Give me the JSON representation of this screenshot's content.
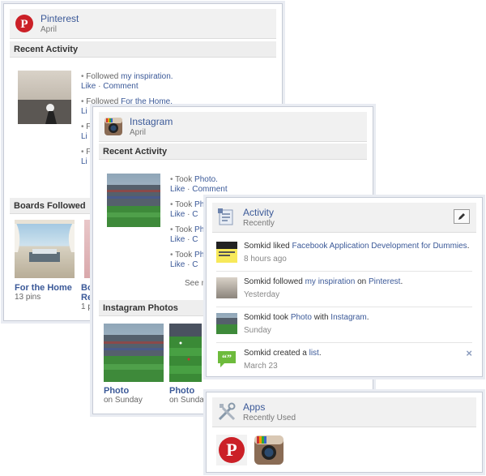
{
  "pinterest": {
    "title": "Pinterest",
    "subtitle": "April",
    "recent_activity_label": "Recent Activity",
    "items": [
      {
        "prefix": "Followed ",
        "link": "my inspiration.",
        "actions": [
          "Like",
          "Comment"
        ]
      },
      {
        "prefix": "Followed ",
        "link": "For the Home.",
        "actions": [
          "Li"
        ]
      },
      {
        "prefix": "Followed ",
        "link": "",
        "actions": [
          "Li"
        ]
      },
      {
        "prefix": "Followed ",
        "link": "",
        "actions": [
          "Li"
        ]
      }
    ],
    "boards_label": "Boards Followed",
    "boards": [
      {
        "title": "For the Home",
        "sub": "13 pins"
      },
      {
        "title": "Bo",
        "title2": "Re",
        "sub": "1 p"
      }
    ]
  },
  "instagram": {
    "title": "Instagram",
    "subtitle": "April",
    "recent_activity_label": "Recent Activity",
    "items": [
      {
        "prefix": "Took ",
        "link": "Photo.",
        "actions": [
          "Like",
          "Comment"
        ]
      },
      {
        "prefix": "Took ",
        "link": "Ph",
        "actions": [
          "Like",
          "C"
        ]
      },
      {
        "prefix": "Took ",
        "link": "Ph",
        "actions": [
          "Like",
          "C"
        ]
      },
      {
        "prefix": "Took ",
        "link": "Ph",
        "actions": [
          "Like",
          "C"
        ]
      }
    ],
    "see_more": "See m",
    "photos_label": "Instagram Photos",
    "photos": [
      {
        "title": "Photo",
        "sub": "on Sunday"
      },
      {
        "title": "Photo",
        "sub": "on Sunday"
      }
    ]
  },
  "activity": {
    "title": "Activity",
    "subtitle": "Recently",
    "edit_icon": "pencil-icon",
    "feed": [
      {
        "pre": "Somkid liked ",
        "link1": "Facebook Application Development for Dummies",
        "mid": ".",
        "link2": "",
        "post": "",
        "time": "8 hours ago",
        "thumb": "book"
      },
      {
        "pre": "Somkid followed ",
        "link1": "my inspiration",
        "mid": " on ",
        "link2": "Pinterest",
        "post": ".",
        "time": "Yesterday",
        "thumb": "photo"
      },
      {
        "pre": "Somkid took ",
        "link1": "Photo",
        "mid": " with ",
        "link2": "Instagram",
        "post": ".",
        "time": "Sunday",
        "thumb": "stadium"
      },
      {
        "pre": "Somkid created a ",
        "link1": "list",
        "mid": ".",
        "link2": "",
        "post": "",
        "time": "March 23",
        "thumb": "quote"
      }
    ],
    "close_glyph": "×"
  },
  "apps": {
    "title": "Apps",
    "subtitle": "Recently Used",
    "icons": [
      "pinterest-app-icon",
      "instagram-app-icon"
    ]
  },
  "colors": {
    "link": "#3b5998",
    "pinterest_red": "#cb2027",
    "panel_border": "#c6cbd6"
  }
}
